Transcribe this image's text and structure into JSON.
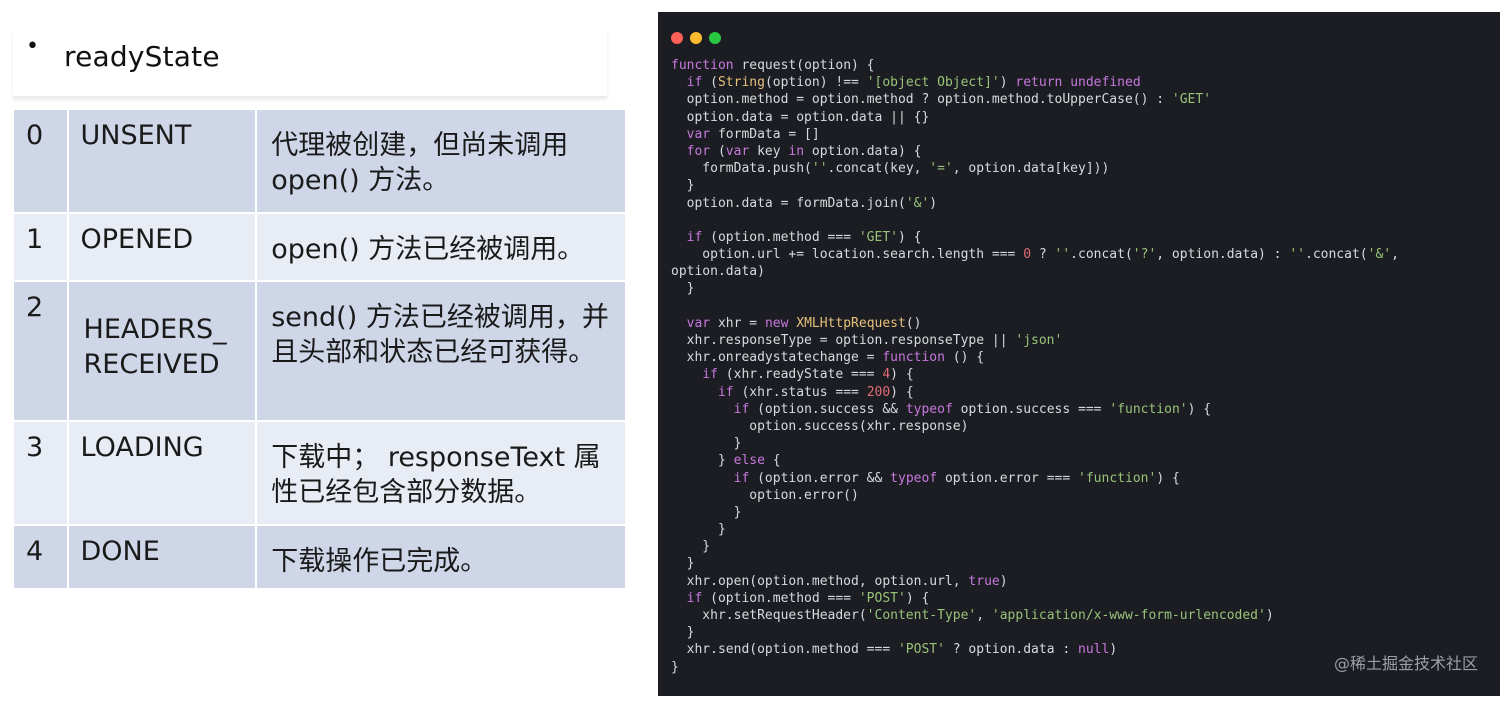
{
  "slide": {
    "bullet": "•",
    "heading": "readyState",
    "rows": [
      {
        "num": "0",
        "name": "UNSENT",
        "desc": "代理被创建，但尚未调用open() 方法。"
      },
      {
        "num": "1",
        "name": "OPENED",
        "desc": "open() 方法已经被调用。"
      },
      {
        "num": "2",
        "name": "HEADERS_ RECEIVED",
        "desc": "send() 方法已经被调用，并且头部和状态已经可获得。"
      },
      {
        "num": "3",
        "name": "LOADING",
        "desc": "下载中； responseText 属性已经包含部分数据。"
      },
      {
        "num": "4",
        "name": "DONE",
        "desc": "下载操作已完成。"
      }
    ]
  },
  "code_window": {
    "controls": [
      "close-dot",
      "minimize-dot",
      "maximize-dot"
    ],
    "colors": {
      "background": "#1c1d22",
      "close": "#fe5f57",
      "minimize": "#febc2e",
      "maximize": "#28c840"
    },
    "lines": [
      "function request(option) {",
      "  if (String(option) !== '[object Object]') return undefined",
      "  option.method = option.method ? option.method.toUpperCase() : 'GET'",
      "  option.data = option.data || {}",
      "  var formData = []",
      "  for (var key in option.data) {",
      "    formData.push(''.concat(key, '=', option.data[key]))",
      "  }",
      "  option.data = formData.join('&')",
      "",
      "  if (option.method === 'GET') {",
      "    option.url += location.search.length === 0 ? ''.concat('?', option.data) : ''.concat('&',",
      "option.data)",
      "  }",
      "",
      "  var xhr = new XMLHttpRequest()",
      "  xhr.responseType = option.responseType || 'json'",
      "  xhr.onreadystatechange = function () {",
      "    if (xhr.readyState === 4) {",
      "      if (xhr.status === 200) {",
      "        if (option.success && typeof option.success === 'function') {",
      "          option.success(xhr.response)",
      "        }",
      "      } else {",
      "        if (option.error && typeof option.error === 'function') {",
      "          option.error()",
      "        }",
      "      }",
      "    }",
      "  }",
      "  xhr.open(option.method, option.url, true)",
      "  if (option.method === 'POST') {",
      "    xhr.setRequestHeader('Content-Type', 'application/x-www-form-urlencoded')",
      "  }",
      "  xhr.send(option.method === 'POST' ? option.data : null)",
      "}"
    ],
    "watermark": "@稀土掘金技术社区"
  }
}
